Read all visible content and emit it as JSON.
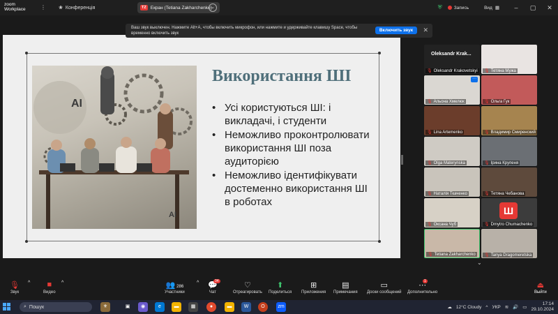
{
  "titlebar": {
    "app_line1": "zoom",
    "app_line2": "Workplace",
    "conference_label": "Конференція",
    "share_badge": "TZ",
    "share_label": "Екран (Tetiana Zakharchenko)",
    "record_label": "Запись",
    "view_label": "Вид"
  },
  "banner": {
    "text": "Ваш звук выключен. Нажмите Alt+A, чтобы включить микрофон, или нажмите и удерживайте клавишу Space, чтобы временно включить звук",
    "button": "Включить звук"
  },
  "slide": {
    "title": "Використання ШІ",
    "bullets": [
      "Усі користуються ШІ: і викладачі, і студенти",
      "Неможливо проконтролювати використання ШІ поза аудиторією",
      "Неможливо ідентифікувати достеменно використання ШІ в роботах"
    ],
    "photo_text_1": "AI",
    "photo_text_2": "AI"
  },
  "gallery": {
    "speaker_name": "Oleksandr Krak...",
    "tiles": [
      {
        "name": "Oleksandr Krakovetskyi",
        "color": "#2a2a2a"
      },
      {
        "name": "Тетяна Мужа",
        "color": "#e9e4e2"
      },
      {
        "name": "Альона Хмелюк",
        "color": "#dad7d2"
      },
      {
        "name": "Ольга Гук",
        "color": "#c25a5a"
      },
      {
        "name": "Lina Artemenko",
        "color": "#6b3d2b"
      },
      {
        "name": "Владимир Смиренский",
        "color": "#a6844f"
      },
      {
        "name": "Olga Materynska",
        "color": "#cfcbc4"
      },
      {
        "name": "Ірина Крупеня",
        "color": "#6b6f74"
      },
      {
        "name": "Наталія Ткаченко",
        "color": "#c9c4bb"
      },
      {
        "name": "Тетяна Чебанова",
        "color": "#5e4a3c"
      },
      {
        "name": "Оксана Чуб",
        "color": "#d7d1c6"
      },
      {
        "name": "Dmytro Chumachenko",
        "color": "#3c3c3c"
      },
      {
        "name": "Tetiana Zakharchenko",
        "color": "#c9b8a8"
      },
      {
        "name": "Tanya Dragomeretska",
        "color": "#b8b1a8"
      }
    ]
  },
  "toolbar": {
    "audio": "Звук",
    "video": "Видео",
    "participants": "Участники",
    "participants_count": "286",
    "chat": "Чат",
    "chat_badge": "34",
    "react": "Отреагировать",
    "share": "Поделиться",
    "apps": "Приложения",
    "notes": "Примечания",
    "whiteboards": "Доски сообщений",
    "more": "Дополнительно",
    "more_badge": "1",
    "leave": "Выйти"
  },
  "taskbar": {
    "search": "Пошук",
    "weather": "12°C  Cloudy",
    "lang": "УКР",
    "time": "17:14",
    "date": "29.10.2024",
    "zoom_icon": "zm"
  }
}
